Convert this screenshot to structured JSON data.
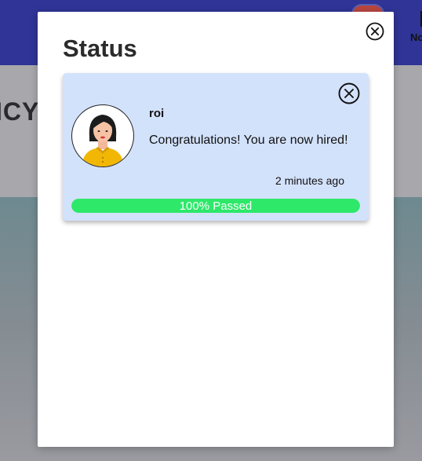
{
  "background": {
    "nav_text": "No",
    "hero_text": "ICY"
  },
  "modal": {
    "title": "Status",
    "close_icon": "close-circle-icon"
  },
  "notification": {
    "sender": "roi",
    "message": "Congratulations! You are now hired!",
    "timestamp": "2 minutes ago",
    "progress_label": "100% Passed",
    "progress_fraction": 1.0,
    "progress_color": "#2ee86a",
    "card_color": "#d3e2fb",
    "close_icon": "close-circle-icon",
    "avatar_icon": "woman-avatar-icon"
  }
}
